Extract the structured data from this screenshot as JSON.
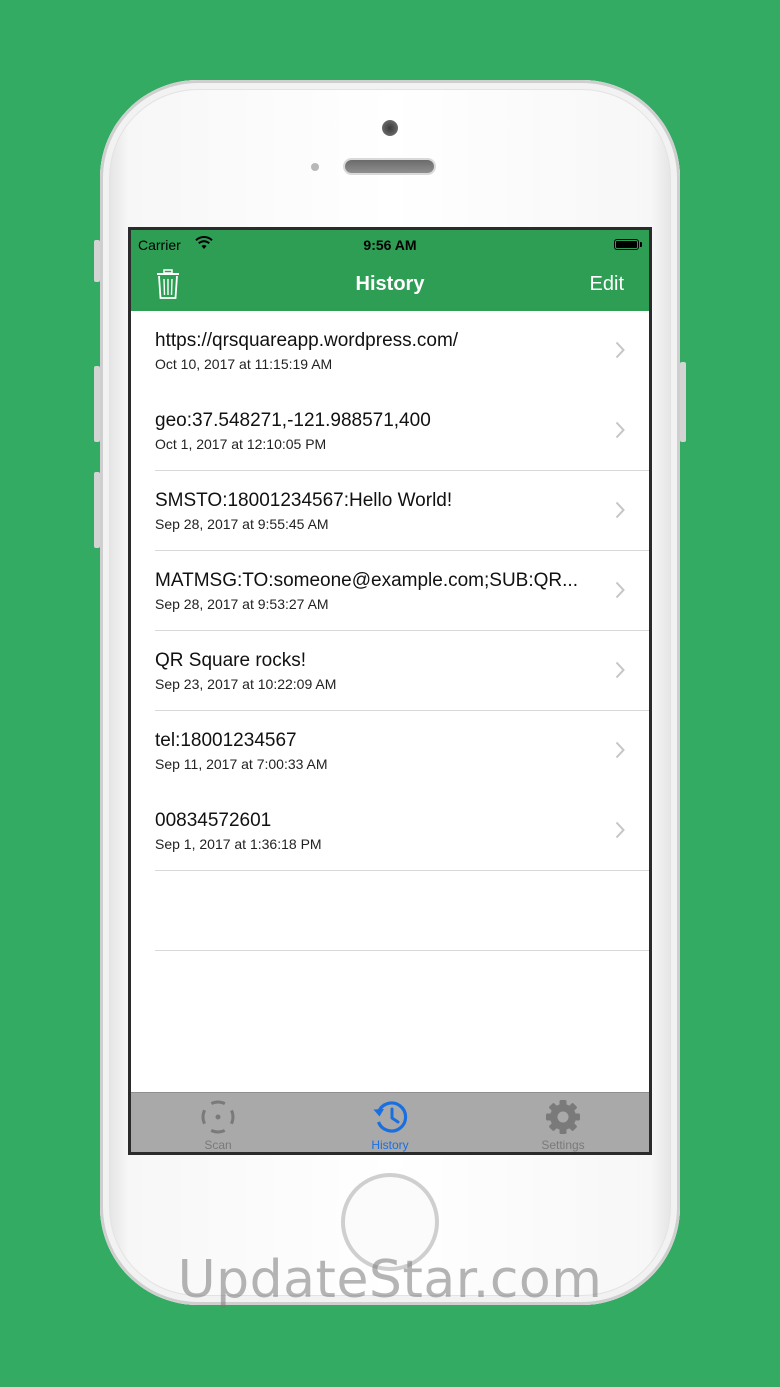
{
  "status_bar": {
    "carrier": "Carrier",
    "time": "9:56 AM"
  },
  "nav_bar": {
    "title": "History",
    "edit_label": "Edit",
    "left_icon": "trash-icon",
    "color": "#2e9e55"
  },
  "history": {
    "items": [
      {
        "title": "https://qrsquareapp.wordpress.com/",
        "date": "Oct 10, 2017 at 11:15:19 AM"
      },
      {
        "title": "geo:37.548271,-121.988571,400",
        "date": "Oct 1, 2017 at 12:10:05 PM"
      },
      {
        "title": "SMSTO:18001234567:Hello World!",
        "date": "Sep 28, 2017 at 9:55:45 AM"
      },
      {
        "title": "MATMSG:TO:someone@example.com;SUB:QR...",
        "date": "Sep 28, 2017 at 9:53:27 AM"
      },
      {
        "title": "QR Square rocks!",
        "date": "Sep 23, 2017 at 10:22:09 AM"
      },
      {
        "title": "tel:18001234567",
        "date": "Sep 11, 2017 at 7:00:33 AM"
      },
      {
        "title": "00834572601",
        "date": "Sep 1, 2017 at 1:36:18 PM"
      }
    ]
  },
  "tab_bar": {
    "tabs": [
      {
        "label": "Scan",
        "icon": "scan-icon",
        "selected": false
      },
      {
        "label": "History",
        "icon": "history-icon",
        "selected": true
      },
      {
        "label": "Settings",
        "icon": "gear-icon",
        "selected": false
      }
    ],
    "selected_color": "#1a6fe0",
    "unselected_color": "#7a7a7a"
  },
  "watermark": "UpdateStar.com"
}
